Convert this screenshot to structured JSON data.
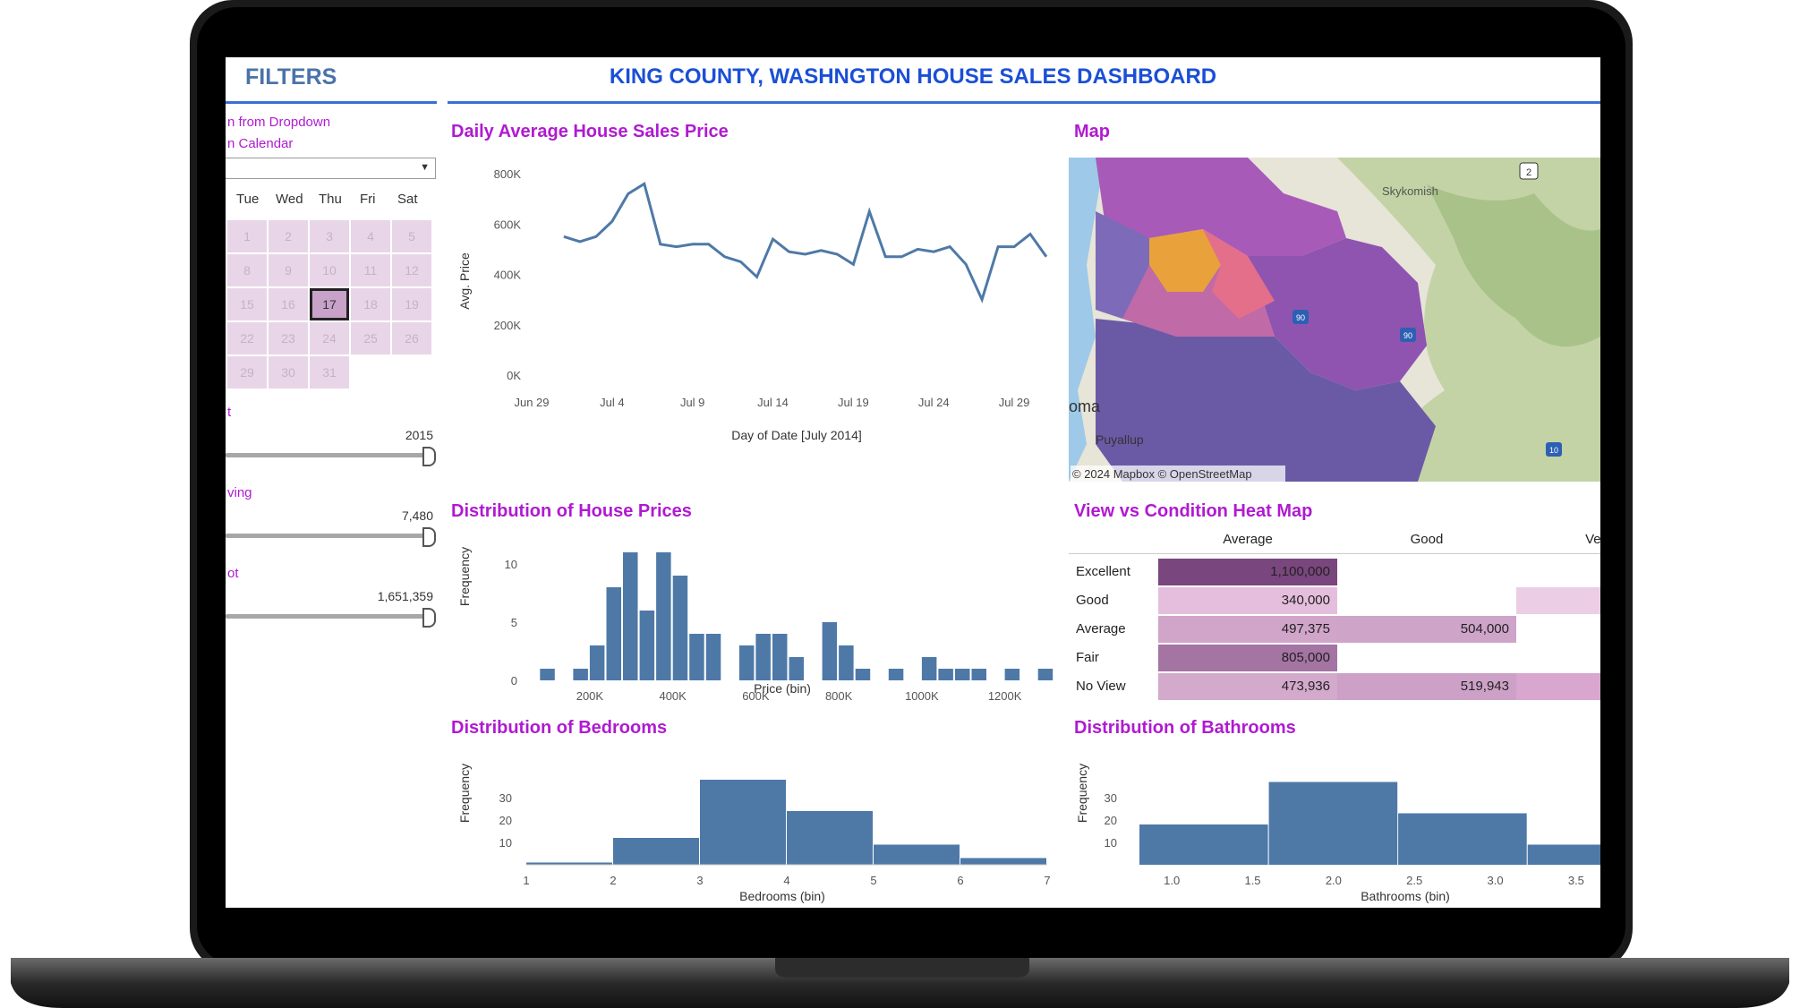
{
  "dashboard": {
    "title": "KING COUNTY, WASHNGTON HOUSE SALES DASHBOARD"
  },
  "filters": {
    "title": "FILTERS",
    "dropdown_hint": "n from Dropdown",
    "calendar_hint": "n Calendar",
    "calendar": {
      "weekdays": [
        "Tue",
        "Wed",
        "Thu",
        "Fri",
        "Sat"
      ],
      "selected_day": "17"
    },
    "sliders": [
      {
        "label": "t",
        "value_label": "2015",
        "fraction": 1.0
      },
      {
        "label": "ving",
        "value_label": "7,480",
        "fraction": 1.0
      },
      {
        "label": "ot",
        "value_label": "1,651,359",
        "fraction": 1.0
      }
    ]
  },
  "charts": {
    "daily": {
      "title": "Daily Average House Sales Price",
      "ylabel": "Avg. Price",
      "xlabel": "Day of Date [July 2014]",
      "yticks": [
        "800K",
        "600K",
        "400K",
        "200K",
        "0K"
      ],
      "xticks": [
        "Jun 29",
        "Jul 4",
        "Jul 9",
        "Jul 14",
        "Jul 19",
        "Jul 24",
        "Jul 29"
      ]
    },
    "map": {
      "title": "Map",
      "labels": [
        "Skykomish",
        "Puyallup",
        "oma",
        "© 2024 Mapbox © OpenStreetMap"
      ],
      "shields": [
        "2",
        "90",
        "90",
        "10"
      ]
    },
    "prices": {
      "title": "Distribution of House Prices",
      "ylabel": "Frequency",
      "xlabel": "Price (bin)",
      "yticks": [
        "10",
        "5",
        "0"
      ],
      "xticks": [
        "200K",
        "400K",
        "600K",
        "800K",
        "1000K",
        "1200K"
      ]
    },
    "heatmap": {
      "title": "View vs Condition Heat Map",
      "columns": [
        "Average",
        "Good",
        "Very G"
      ],
      "rows": [
        "Excellent",
        "Good",
        "Average",
        "Fair",
        "No View"
      ]
    },
    "bedrooms": {
      "title": "Distribution of Bedrooms",
      "ylabel": "Frequency",
      "xlabel": "Bedrooms (bin)",
      "yticks": [
        "30",
        "20",
        "10"
      ],
      "xticks": [
        "1",
        "2",
        "3",
        "4",
        "5",
        "6",
        "7"
      ]
    },
    "bathrooms": {
      "title": "Distribution of Bathrooms",
      "ylabel": "Frequency",
      "xlabel": "Bathrooms (bin)",
      "yticks": [
        "30",
        "20",
        "10"
      ],
      "xticks": [
        "1.0",
        "1.5",
        "2.0",
        "2.5",
        "3.0",
        "3.5"
      ]
    }
  },
  "chart_data": [
    {
      "type": "line",
      "title": "Daily Average House Sales Price",
      "xlabel": "Day of Date [July 2014]",
      "ylabel": "Avg. Price",
      "x": [
        "2014-07-01",
        "2014-07-02",
        "2014-07-03",
        "2014-07-04",
        "2014-07-05",
        "2014-07-06",
        "2014-07-07",
        "2014-07-08",
        "2014-07-09",
        "2014-07-10",
        "2014-07-11",
        "2014-07-12",
        "2014-07-13",
        "2014-07-14",
        "2014-07-15",
        "2014-07-16",
        "2014-07-17",
        "2014-07-18",
        "2014-07-19",
        "2014-07-20",
        "2014-07-21",
        "2014-07-22",
        "2014-07-23",
        "2014-07-24",
        "2014-07-25",
        "2014-07-26",
        "2014-07-27",
        "2014-07-28",
        "2014-07-29",
        "2014-07-30",
        "2014-07-31"
      ],
      "y": [
        550000,
        530000,
        550000,
        610000,
        720000,
        760000,
        520000,
        510000,
        520000,
        520000,
        470000,
        450000,
        390000,
        540000,
        490000,
        480000,
        495000,
        480000,
        440000,
        650000,
        470000,
        470000,
        500000,
        490000,
        510000,
        440000,
        300000,
        510000,
        510000,
        560000,
        470000
      ],
      "ylim": [
        0,
        800000
      ],
      "xlim": [
        "2014-06-29",
        "2014-07-31"
      ]
    },
    {
      "type": "bar",
      "title": "Distribution of House Prices",
      "xlabel": "Price (bin)",
      "ylabel": "Frequency",
      "x": [
        80000,
        120000,
        160000,
        200000,
        240000,
        280000,
        320000,
        360000,
        400000,
        440000,
        480000,
        520000,
        560000,
        600000,
        640000,
        680000,
        720000,
        760000,
        800000,
        840000,
        880000,
        920000,
        960000,
        1000000,
        1040000,
        1080000,
        1120000,
        1160000,
        1200000,
        1240000,
        1280000
      ],
      "values": [
        1,
        0,
        1,
        3,
        8,
        11,
        6,
        11,
        9,
        4,
        4,
        0,
        3,
        4,
        4,
        2,
        0,
        5,
        3,
        1,
        0,
        1,
        0,
        2,
        1,
        1,
        1,
        0,
        1,
        0,
        1
      ],
      "ylim": [
        0,
        12
      ]
    },
    {
      "type": "heatmap",
      "title": "View vs Condition Heat Map",
      "columns": [
        "Average",
        "Good",
        "Very G"
      ],
      "rows": [
        "Excellent",
        "Good",
        "Average",
        "Fair",
        "No View"
      ],
      "values": [
        [
          "1,100,000",
          "",
          ""
        ],
        [
          "340,000",
          "",
          ""
        ],
        [
          "497,375",
          "504,000",
          ""
        ],
        [
          "805,000",
          "",
          ""
        ],
        [
          "473,936",
          "519,943",
          ""
        ]
      ]
    },
    {
      "type": "bar",
      "title": "Distribution of Bedrooms",
      "xlabel": "Bedrooms (bin)",
      "ylabel": "Frequency",
      "x": [
        1,
        2,
        3,
        4,
        5,
        6
      ],
      "values": [
        1,
        12,
        38,
        24,
        9,
        3
      ],
      "ylim": [
        0,
        40
      ]
    },
    {
      "type": "bar",
      "title": "Distribution of Bathrooms",
      "xlabel": "Bathrooms (bin)",
      "ylabel": "Frequency",
      "x": [
        0.8,
        1.6,
        2.4,
        3.2
      ],
      "values": [
        18,
        37,
        23,
        9
      ],
      "ylim": [
        0,
        40
      ]
    }
  ]
}
